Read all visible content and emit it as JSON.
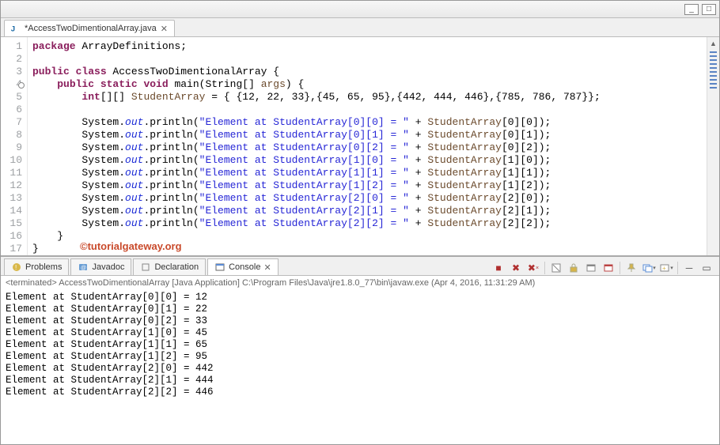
{
  "window": {
    "min": "_",
    "max": "□"
  },
  "editor_tab": {
    "title": "*AccessTwoDimentionalArray.java",
    "close": "✕"
  },
  "code": {
    "lines": [
      "1",
      "2",
      "3",
      "4",
      "5",
      "6",
      "7",
      "8",
      "9",
      "10",
      "11",
      "12",
      "13",
      "14",
      "15",
      "16",
      "17"
    ],
    "l1_kw": "package",
    "l1_rest": " ArrayDefinitions;",
    "l3_kw1": "public",
    "l3_kw2": " class",
    "l3_cls": " AccessTwoDimentionalArray",
    "l3_brace": " {",
    "l4_lead": "    ",
    "l4_kw1": "public",
    "l4_kw2": " static",
    "l4_kw3": " void",
    "l4_mth": " main(String[] ",
    "l4_arg": "args",
    "l4_end": ") {",
    "l5_lead": "        ",
    "l5_kw": "int",
    "l5_decl": "[][] ",
    "l5_var": "StudentArray",
    "l5_init": " = { {12, 22, 33},{45, 65, 95},{442, 444, 446},{785, 786, 787}};",
    "prn_lead": "        System.",
    "prn_out": "out",
    "prn_call": ".println(",
    "prn_plus": " + ",
    "prn_end": ");",
    "s00": "\"Element at StudentArray[0][0] = \"",
    "v00": "StudentArray",
    "i00": "[0][0]",
    "s01": "\"Element at StudentArray[0][1] = \"",
    "i01": "[0][1]",
    "s02": "\"Element at StudentArray[0][2] = \"",
    "i02": "[0][2]",
    "s10": "\"Element at StudentArray[1][0] = \"",
    "i10": "[1][0]",
    "s11": "\"Element at StudentArray[1][1] = \"",
    "i11": "[1][1]",
    "s12": "\"Element at StudentArray[1][2] = \"",
    "i12": "[1][2]",
    "s20": "\"Element at StudentArray[2][0] = \"",
    "i20": "[2][0]",
    "s21": "\"Element at StudentArray[2][1] = \"",
    "i21": "[2][1]",
    "s22": "\"Element at StudentArray[2][2] = \"",
    "i22": "[2][2]",
    "l16": "    }",
    "l17": "}"
  },
  "watermark": "©tutorialgateway.org",
  "bottom_tabs": {
    "problems": "Problems",
    "javadoc": "Javadoc",
    "declaration": "Declaration",
    "console": "Console"
  },
  "console": {
    "info": "<terminated> AccessTwoDimentionalArray [Java Application] C:\\Program Files\\Java\\jre1.8.0_77\\bin\\javaw.exe (Apr 4, 2016, 11:31:29 AM)",
    "out": "Element at StudentArray[0][0] = 12\nElement at StudentArray[0][1] = 22\nElement at StudentArray[0][2] = 33\nElement at StudentArray[1][0] = 45\nElement at StudentArray[1][1] = 65\nElement at StudentArray[1][2] = 95\nElement at StudentArray[2][0] = 442\nElement at StudentArray[2][1] = 444\nElement at StudentArray[2][2] = 446"
  }
}
